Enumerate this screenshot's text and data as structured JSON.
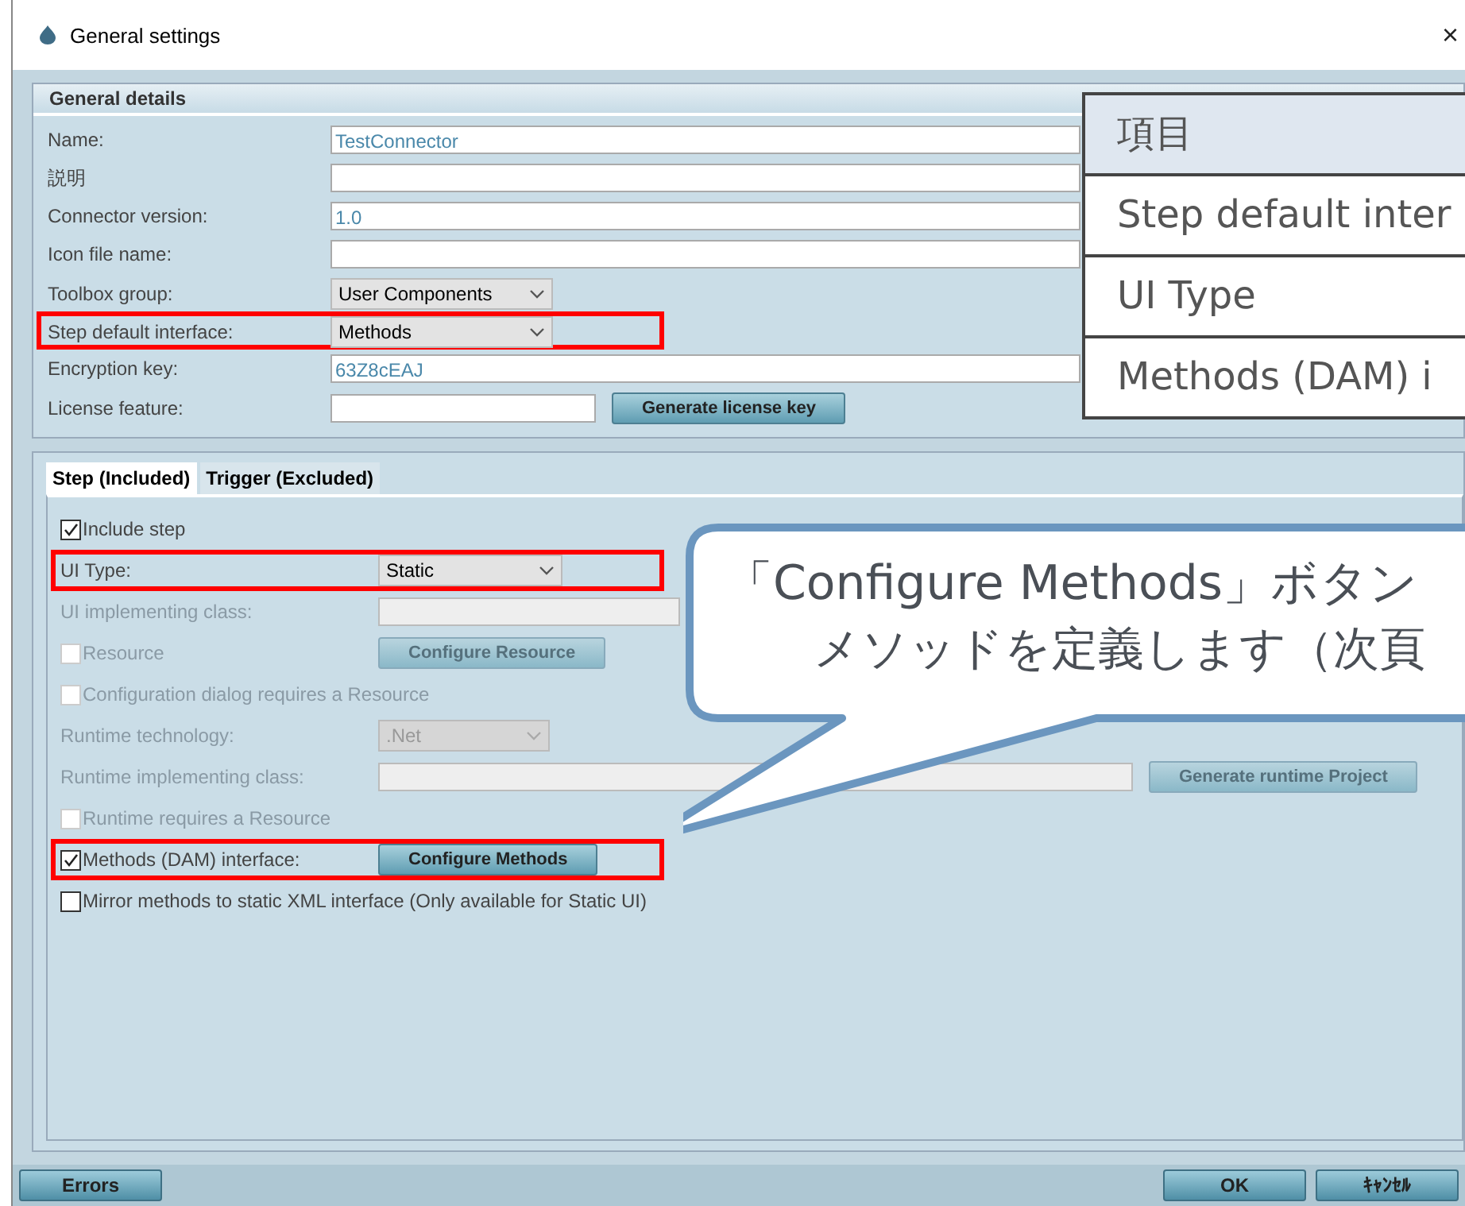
{
  "window": {
    "title": "General settings",
    "close": "×"
  },
  "general_details": {
    "title": "General details",
    "rows": [
      {
        "kind": "field",
        "label": "Name:",
        "value": "TestConnector",
        "highlighted": false
      },
      {
        "kind": "field",
        "label": "説明",
        "highlighted": false
      },
      {
        "kind": "field",
        "label": "Connector version:",
        "value": "1.0",
        "highlighted": false
      },
      {
        "kind": "field",
        "label": "Icon file name:",
        "highlighted": false
      },
      {
        "kind": "select",
        "label": "Toolbox group:",
        "value": "User Components",
        "highlighted": false
      },
      {
        "kind": "select",
        "label": "Step default interface:",
        "value": "Methods",
        "highlighted": true
      },
      {
        "kind": "field",
        "label": "Encryption key:",
        "value": "63Z8cEAJ",
        "highlighted": false
      },
      {
        "kind": "short_field",
        "label": "License feature:",
        "highlighted": false,
        "button": {
          "label": "Generate license key",
          "disabled": false
        }
      }
    ]
  },
  "tabs": [
    {
      "label": "Step (Included)",
      "selected": true
    },
    {
      "label": "Trigger (Excluded)",
      "selected": false
    }
  ],
  "step_rows": [
    {
      "kind": "check",
      "label": "Include step",
      "checked": true,
      "disabled": false,
      "highlighted": false
    },
    {
      "kind": "select",
      "label": "UI Type:",
      "value": "Static",
      "disabled": false,
      "highlighted": true
    },
    {
      "kind": "field",
      "label": "UI implementing class:",
      "disabled": true,
      "highlighted": false
    },
    {
      "kind": "check",
      "label": "Resource",
      "checked": false,
      "disabled": true,
      "highlighted": false,
      "button": {
        "label": "Configure Resource",
        "disabled": true
      }
    },
    {
      "kind": "check",
      "label": "Configuration dialog requires a Resource",
      "checked": false,
      "disabled": true,
      "highlighted": false
    },
    {
      "kind": "select",
      "label": "Runtime technology:",
      "value": ".Net",
      "disabled": true,
      "highlighted": false
    },
    {
      "kind": "field",
      "label": "Runtime implementing class:",
      "disabled": true,
      "highlighted": false,
      "button": {
        "label": "Generate runtime Project",
        "disabled": true
      }
    },
    {
      "kind": "check",
      "label": "Runtime requires a Resource",
      "checked": false,
      "disabled": true,
      "highlighted": false
    },
    {
      "kind": "check",
      "label": "Methods (DAM) interface:",
      "checked": true,
      "disabled": false,
      "highlighted": true,
      "button": {
        "label": "Configure Methods",
        "disabled": false
      }
    },
    {
      "kind": "check",
      "label": "Mirror methods to static XML interface (Only available for Static UI)",
      "checked": false,
      "disabled": false,
      "highlighted": false
    }
  ],
  "footer": {
    "left_buttons": [
      "Errors"
    ],
    "right_buttons": [
      "OK",
      "ｷｬﾝｾﾙ"
    ]
  },
  "annotation_table": {
    "header": "項目",
    "rows": [
      "Step default inter",
      "UI Type",
      "Methods (DAM) i"
    ]
  },
  "callout": {
    "lines": [
      "「Configure Methods」ボタン",
      "メソッドを定義します（次頁"
    ]
  }
}
